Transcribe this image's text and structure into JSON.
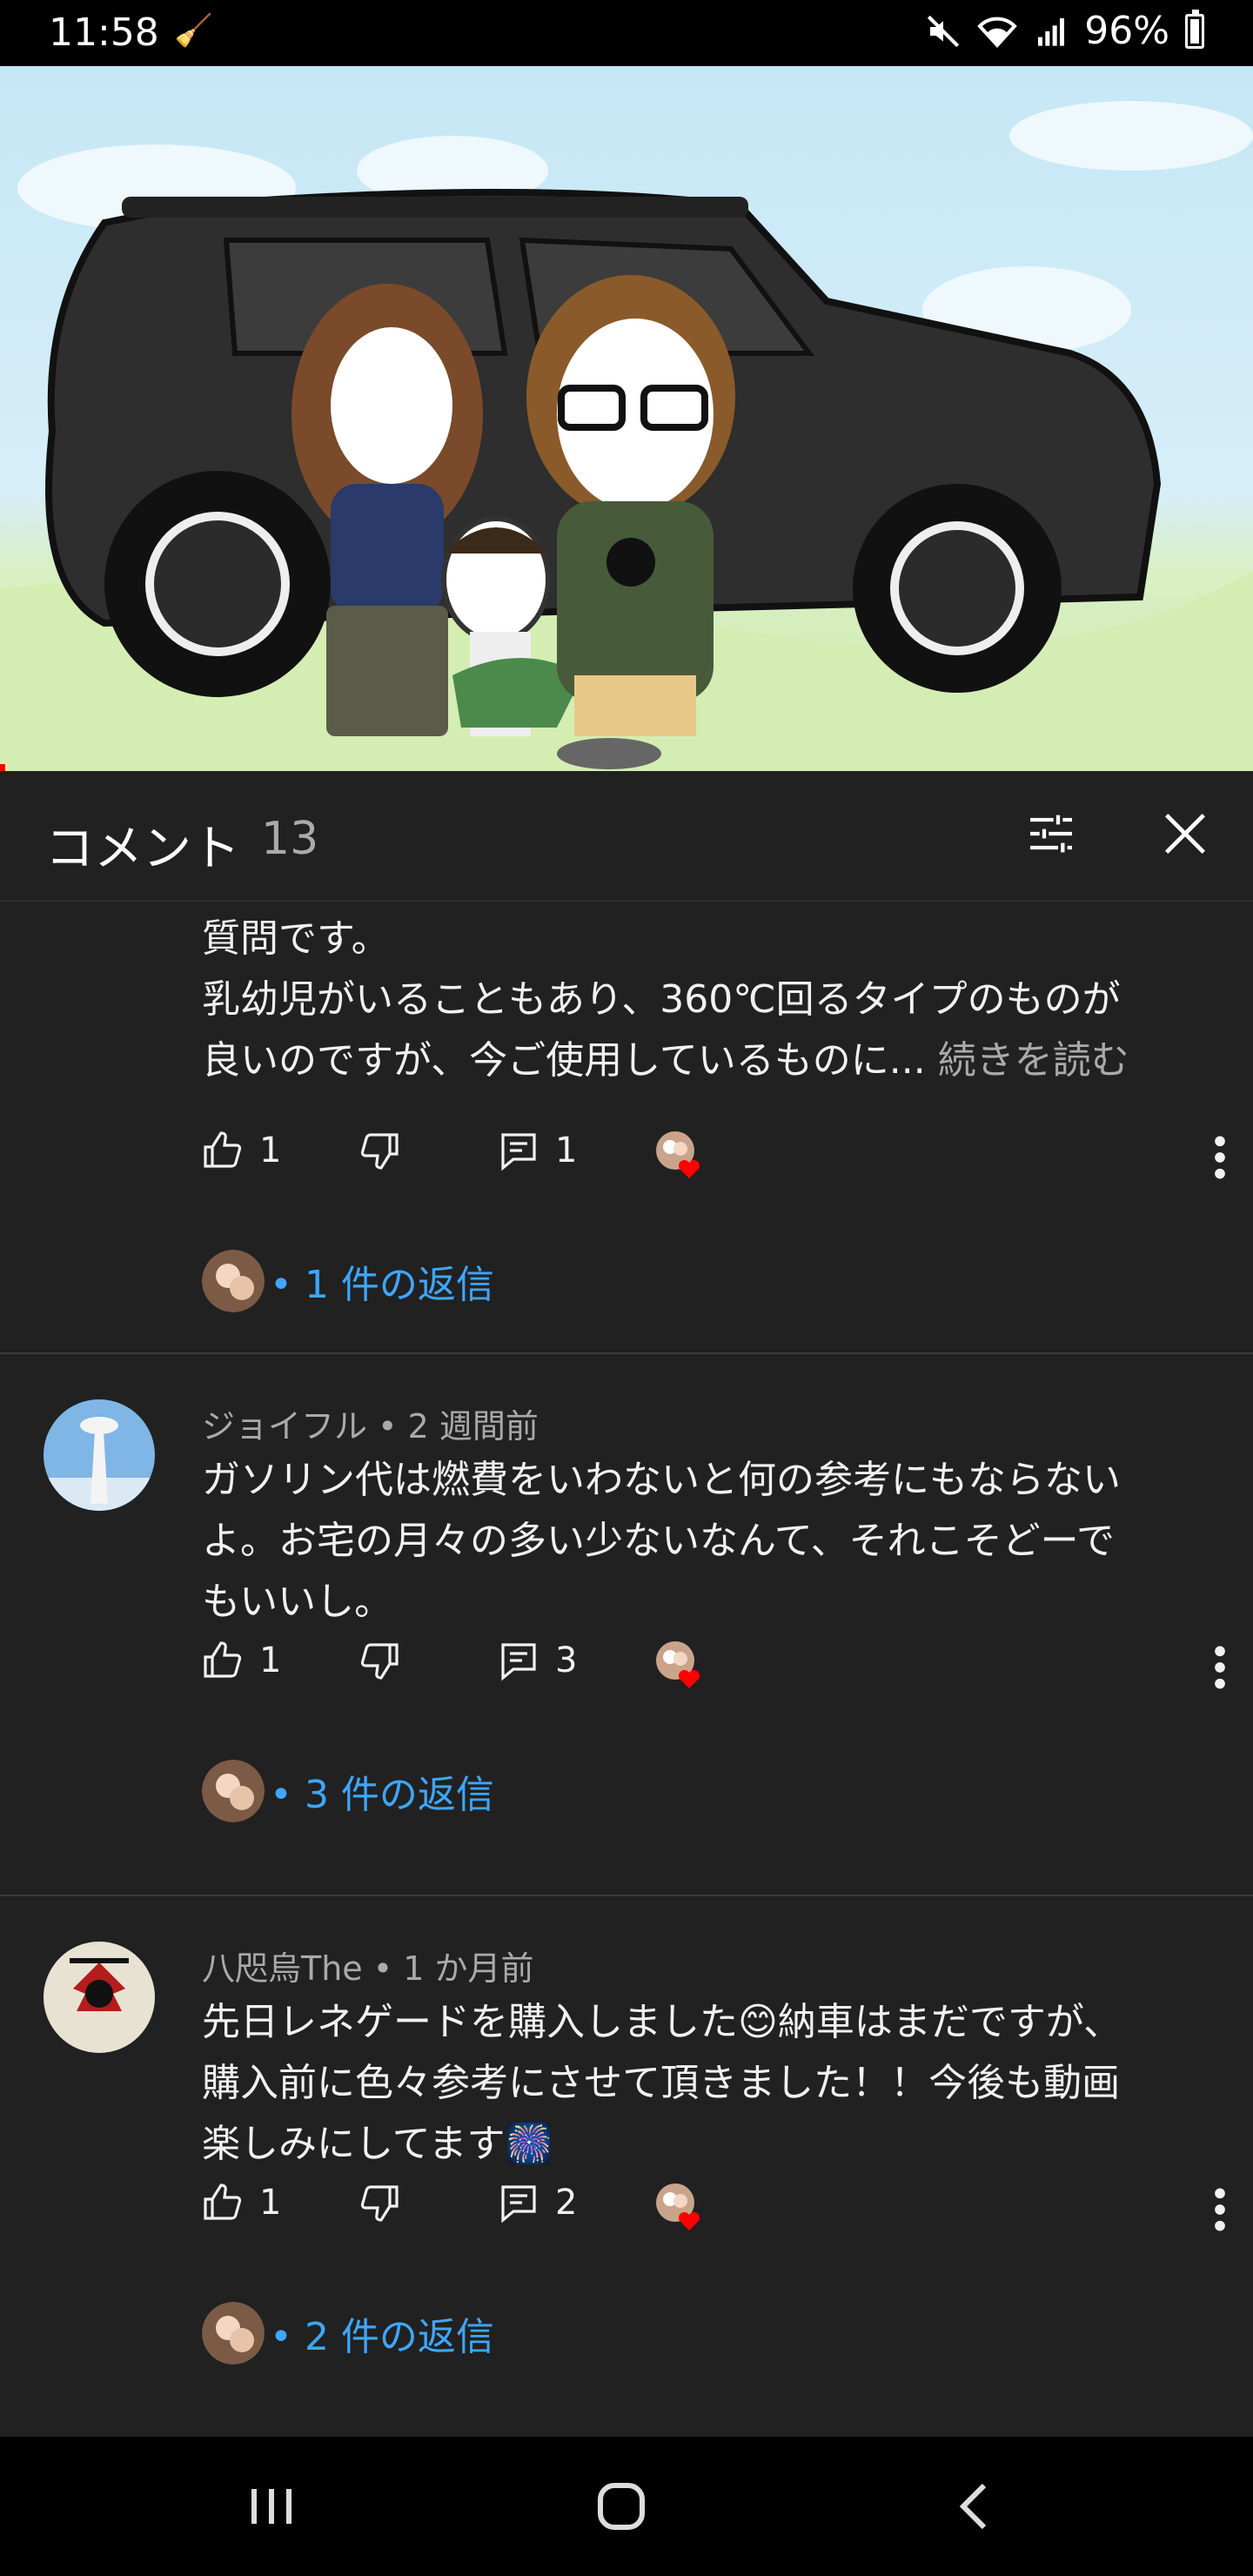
{
  "status_bar": {
    "time": "11:58",
    "battery": "96%"
  },
  "header": {
    "title": "コメント",
    "count": "13"
  },
  "comments": [
    {
      "author": "",
      "age": "",
      "text": "質問です。\n乳幼児がいることもあり、360℃回るタイプのものが\n良いのですが、今ご使用しているものに...",
      "read_more": "続きを読む",
      "likes": "1",
      "reply_count": "1",
      "replies_label": "• 1 件の返信"
    },
    {
      "author": "ジョイフル",
      "age": "• 2 週間前",
      "text": "ガソリン代は燃費をいわないと何の参考にもならない\nよ。お宅の月々の多い少ないなんて、それこそどーで\nもいいし。",
      "likes": "1",
      "reply_count": "3",
      "replies_label": "• 3 件の返信"
    },
    {
      "author": "八咫烏The",
      "age": "• 1 か月前",
      "text": "先日レネゲードを購入しました😊納車はまだですが、\n購入前に色々参考にさせて頂きました！！今後も動画\n楽しみにしてます🎆",
      "likes": "1",
      "reply_count": "2",
      "replies_label": "• 2 件の返信"
    }
  ],
  "icons": {
    "status_left": [
      "mute-icon",
      "wifi-icon",
      "signal-icon",
      "battery-icon"
    ],
    "header": [
      "filter-icon",
      "close-icon"
    ],
    "actions": [
      "like-icon",
      "dislike-icon",
      "reply-icon",
      "creator-heart-icon",
      "more-icon"
    ],
    "nav": [
      "recent-apps-icon",
      "home-icon",
      "back-icon"
    ]
  },
  "colors": {
    "background": "#212121",
    "link": "#3ea6ff",
    "muted": "#aaaaaa",
    "heart": "#ff0000"
  }
}
